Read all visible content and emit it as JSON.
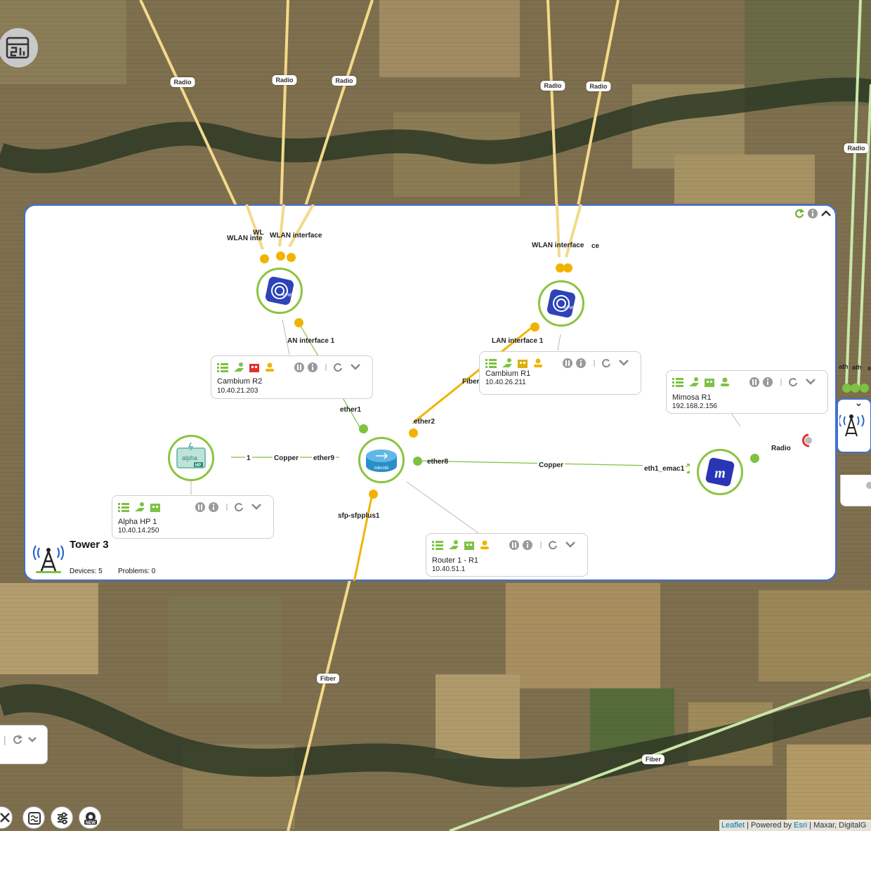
{
  "links": {
    "radio_labels": [
      "Radio",
      "Radio",
      "Radio",
      "Radio",
      "Radio",
      "Radio"
    ],
    "radio_right_edge": "Radio",
    "fiber_bottom": "Fiber",
    "fiber_bottom_right": "Fiber"
  },
  "group": {
    "name": "Tower 3",
    "devices": "Devices: 5",
    "problems": "Problems: 0"
  },
  "ports": {
    "wlan_left_1": "WLAN inte",
    "wlan_left_2": "WL",
    "wlan_left_3": "WLAN interface",
    "wlan_right_1": "WLAN interface",
    "wlan_right_2": "ce",
    "lan_left": "AN interface 1",
    "lan_right": "LAN interface 1",
    "fiber_mid": "Fiber",
    "ether1": "ether1",
    "ether2": "ether2",
    "ether8": "ether8",
    "ether9": "ether9",
    "copper_left": "Copper",
    "copper_right": "Copper",
    "one": "1",
    "eth1_emac1": "eth1_emac1",
    "radio_mimosa": "Radio",
    "sfp": "sfp-sfpplus1",
    "ath1": "ath",
    "ath2": "ath",
    "ath3": "a"
  },
  "devices": [
    {
      "name": "Cambium R2",
      "ip": "10.40.21.203"
    },
    {
      "name": "Cambium R1",
      "ip": "10.40.26.211"
    },
    {
      "name": "Mimosa R1",
      "ip": "192.168.2.156"
    },
    {
      "name": "Alpha HP 1",
      "ip": "10.40.14.250"
    },
    {
      "name": "Router 1 - R1",
      "ip": "10.40.51.1"
    }
  ],
  "icons": {
    "node_epmp": "epmp-icon",
    "node_mikrotik": "mikrotik-router-icon",
    "node_mimosa": "mimosa-icon",
    "node_alpha": "alpha-hp-power-icon",
    "tower": "tower-icon"
  },
  "node_text": {
    "epmp": "ePMP",
    "mikrotik": "mikrotik",
    "mimosa": "m",
    "alpha": "alpha",
    "hp": "HP"
  },
  "attribution": {
    "leaflet": "Leaflet",
    "sep1": " | Powered by ",
    "esri": "Esri",
    "rest": " | Maxar, DigitalG"
  },
  "colors": {
    "accent_blue": "#3f6fd6",
    "ok_green": "#7dc242",
    "warn_yellow": "#f0b400",
    "alert_red": "#e0312d"
  }
}
